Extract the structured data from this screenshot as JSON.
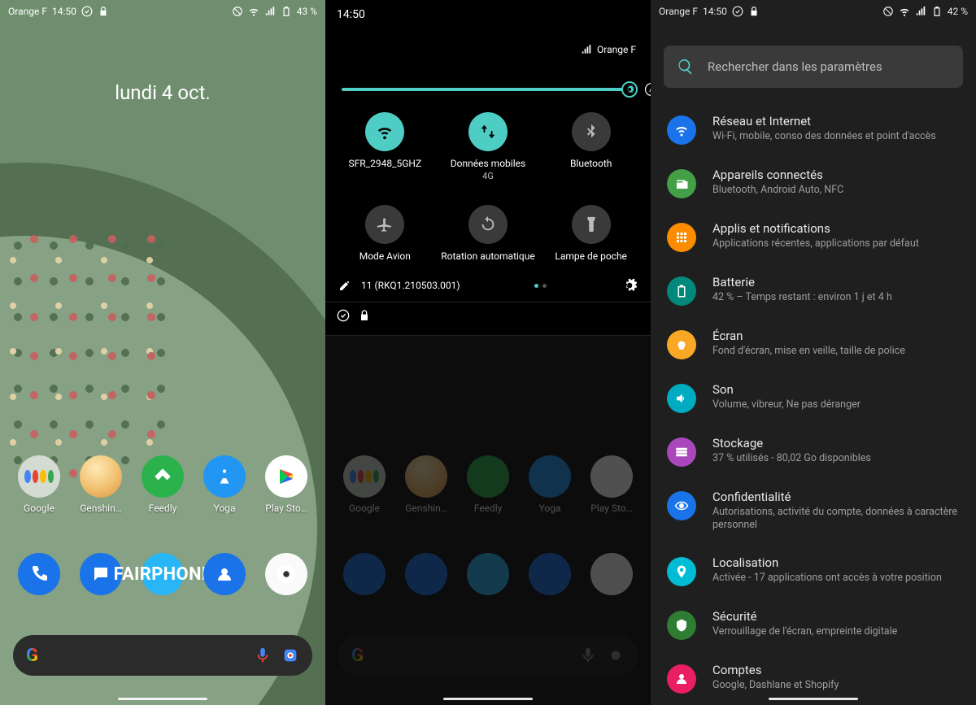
{
  "home": {
    "status": {
      "carrier": "Orange F",
      "time": "14:50",
      "battery": "43 %"
    },
    "date": "lundi 4 oct.",
    "apps": [
      {
        "label": "Google"
      },
      {
        "label": "Genshin…"
      },
      {
        "label": "Feedly"
      },
      {
        "label": "Yoga"
      },
      {
        "label": "Play Sto…"
      }
    ],
    "dock": [
      {
        "name": "phone"
      },
      {
        "name": "messages"
      },
      {
        "name": "fairphone",
        "text": "FAIRPHONE"
      },
      {
        "name": "contacts"
      },
      {
        "name": "camera"
      }
    ]
  },
  "qs": {
    "clock": "14:50",
    "carrier": "Orange F",
    "tiles": [
      {
        "label": "SFR_2948_5GHZ",
        "sub": "",
        "on": true,
        "icon": "wifi"
      },
      {
        "label": "Données mobiles",
        "sub": "4G",
        "on": true,
        "icon": "data"
      },
      {
        "label": "Bluetooth",
        "sub": "",
        "on": false,
        "icon": "bt"
      },
      {
        "label": "Mode Avion",
        "sub": "",
        "on": false,
        "icon": "plane"
      },
      {
        "label": "Rotation automatique",
        "sub": "",
        "on": false,
        "icon": "rotate"
      },
      {
        "label": "Lampe de poche",
        "sub": "",
        "on": false,
        "icon": "torch"
      }
    ],
    "version": "11 (RKQ1.210503.001)",
    "dim_apps": [
      "Google",
      "Genshin…",
      "Feedly",
      "Yoga",
      "Play Sto…"
    ]
  },
  "settings": {
    "status": {
      "carrier": "Orange F",
      "time": "14:50",
      "battery": "42 %"
    },
    "search_placeholder": "Rechercher dans les paramètres",
    "items": [
      {
        "title": "Réseau et Internet",
        "sub": "Wi-Fi, mobile, conso des données et point d'accès",
        "color": "c-net",
        "icon": "wifi"
      },
      {
        "title": "Appareils connectés",
        "sub": "Bluetooth, Android Auto, NFC",
        "color": "c-dev",
        "icon": "devices"
      },
      {
        "title": "Applis et notifications",
        "sub": "Applications récentes, applications par défaut",
        "color": "c-apps",
        "icon": "apps"
      },
      {
        "title": "Batterie",
        "sub": "42 % – Temps restant : environ 1 j et 4 h",
        "color": "c-bat",
        "icon": "battery"
      },
      {
        "title": "Écran",
        "sub": "Fond d'écran, mise en veille, taille de police",
        "color": "c-scr",
        "icon": "screen"
      },
      {
        "title": "Son",
        "sub": "Volume, vibreur, Ne pas déranger",
        "color": "c-snd",
        "icon": "sound"
      },
      {
        "title": "Stockage",
        "sub": "37 % utilisés - 80,02 Go disponibles",
        "color": "c-sto",
        "icon": "storage"
      },
      {
        "title": "Confidentialité",
        "sub": "Autorisations, activité du compte, données à caractère personnel",
        "color": "c-priv",
        "icon": "privacy"
      },
      {
        "title": "Localisation",
        "sub": "Activée - 17 applications ont accès à votre position",
        "color": "c-loc",
        "icon": "location"
      },
      {
        "title": "Sécurité",
        "sub": "Verrouillage de l'écran, empreinte digitale",
        "color": "c-sec",
        "icon": "security"
      },
      {
        "title": "Comptes",
        "sub": "Google, Dashlane et Shopify",
        "color": "c-acc",
        "icon": "accounts"
      }
    ]
  }
}
